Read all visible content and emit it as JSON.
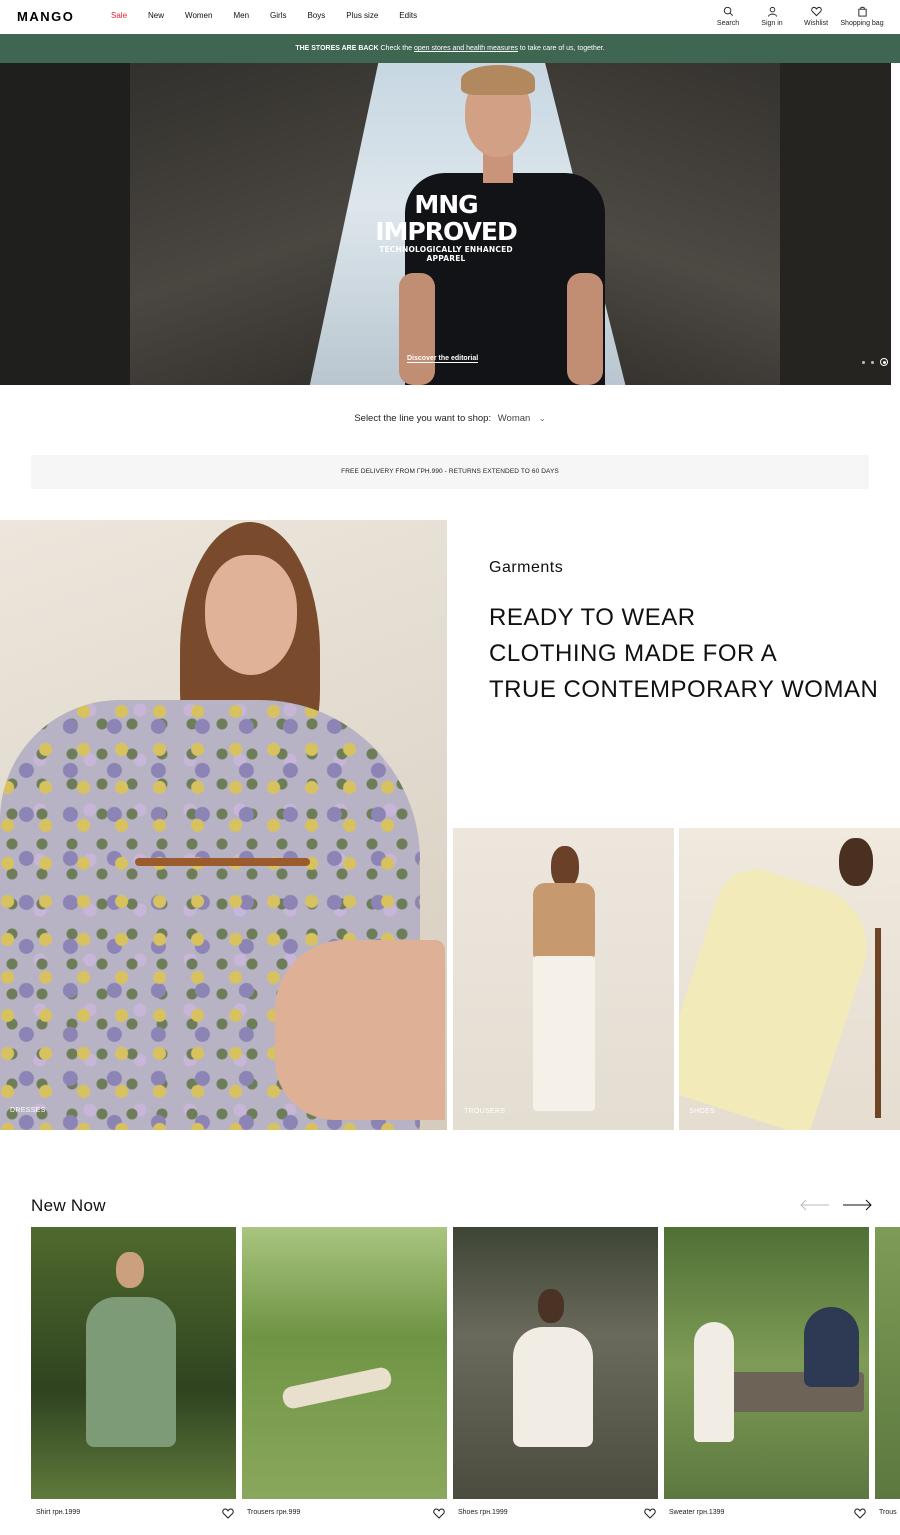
{
  "header": {
    "logo": "MANGO",
    "nav": [
      {
        "label": "Sale",
        "name": "nav-sale"
      },
      {
        "label": "New",
        "name": "nav-new"
      },
      {
        "label": "Women",
        "name": "nav-women"
      },
      {
        "label": "Men",
        "name": "nav-men"
      },
      {
        "label": "Girls",
        "name": "nav-girls"
      },
      {
        "label": "Boys",
        "name": "nav-boys"
      },
      {
        "label": "Plus size",
        "name": "nav-plus-size"
      },
      {
        "label": "Edits",
        "name": "nav-edits"
      }
    ],
    "icons": {
      "search": "Search",
      "signin": "Sign in",
      "wishlist": "Wishlist",
      "bag": "Shopping bag"
    }
  },
  "banner": {
    "bold": "THE STORES ARE BACK",
    "pre": "Check the",
    "link": "open stores and health measures",
    "post": "to take care of us, together."
  },
  "hero": {
    "title_line1": "MNG",
    "title_line2": "IMPROVED",
    "subtitle": "TECHNOLOGICALLY ENHANCED APPAREL",
    "link": "Discover the editorial"
  },
  "line_select": {
    "label": "Select the line you want to shop:",
    "value": "Woman"
  },
  "delivery": "FREE DELIVERY FROM ГРН.990 - RETURNS EXTENDED TO 60 DAYS",
  "garments": {
    "kicker": "Garments",
    "headline": [
      "READY TO WEAR",
      "CLOTHING MADE FOR A",
      "TRUE CONTEMPORARY WOMAN"
    ],
    "tiles": {
      "dresses": "DRESSES",
      "trousers": "TROUSERS",
      "shoes": "SHOES"
    }
  },
  "new_now": {
    "title": "New Now",
    "products": [
      {
        "label": "Shirt грн.1999"
      },
      {
        "label": "Trousers грн.999"
      },
      {
        "label": "Shoes грн.1999"
      },
      {
        "label": "Sweater грн.1399"
      },
      {
        "label": "Trous"
      }
    ]
  }
}
